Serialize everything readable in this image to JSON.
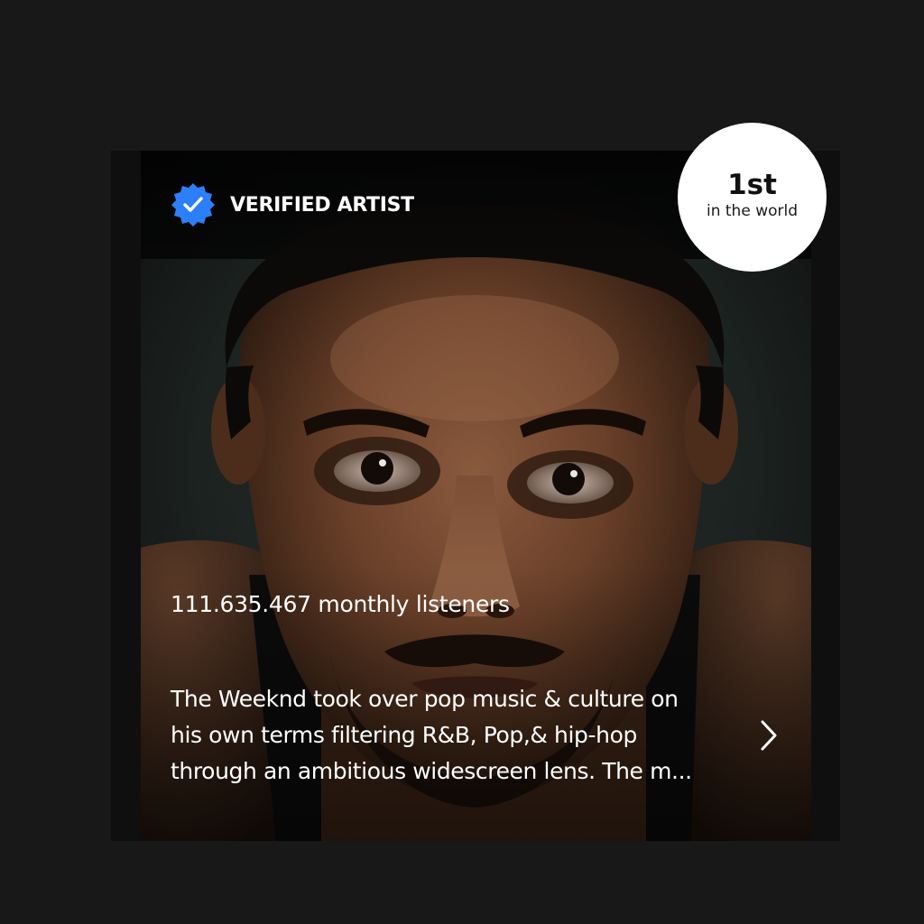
{
  "card": {
    "verified_label": "VERIFIED ARTIST",
    "monthly_listeners": "111.635.467 monthly listeners",
    "bio_lines": [
      "The Weeknd took over pop music & culture on",
      "his own terms filtering R&B, Pop,& hip-hop",
      "through an ambitious widescreen lens. The m..."
    ]
  },
  "rank": {
    "value": "1st",
    "caption": "in the world"
  },
  "icons": {
    "verified": "verified-badge-icon",
    "more": "chevron-right-icon"
  },
  "colors": {
    "background": "#181818",
    "verified_blue": "#2d7ff9",
    "text": "#ffffff",
    "rank_badge": "#ffffff"
  }
}
